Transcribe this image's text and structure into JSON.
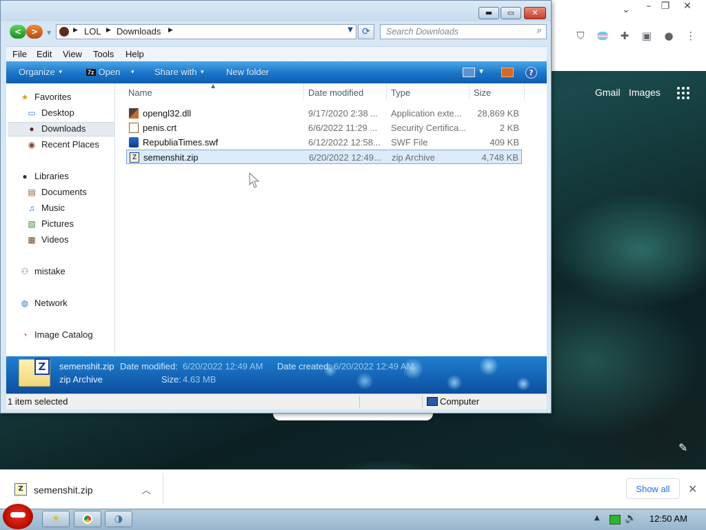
{
  "chrome": {
    "gmail_label": "Gmail",
    "images_label": "Images"
  },
  "explorer": {
    "address": {
      "crumbs": [
        "LOL",
        "Downloads"
      ]
    },
    "search": {
      "placeholder": "Search Downloads"
    },
    "menu": [
      "File",
      "Edit",
      "View",
      "Tools",
      "Help"
    ],
    "commands": {
      "organize": "Organize",
      "open": "Open",
      "share_with": "Share with",
      "new_folder": "New folder"
    },
    "nav": {
      "favorites": "Favorites",
      "desktop": "Desktop",
      "downloads": "Downloads",
      "recent_places": "Recent Places",
      "libraries": "Libraries",
      "documents": "Documents",
      "music": "Music",
      "pictures": "Pictures",
      "videos": "Videos",
      "mistake": "mistake",
      "network": "Network",
      "image_catalog": "Image Catalog"
    },
    "columns": {
      "name": "Name",
      "date_modified": "Date modified",
      "type": "Type",
      "size": "Size"
    },
    "files": [
      {
        "name": "opengl32.dll",
        "date": "9/17/2020 2:38 ...",
        "type": "Application exte...",
        "size": "28,869 KB",
        "icon": "dll-icon"
      },
      {
        "name": "penis.crt",
        "date": "6/6/2022 11:29 ...",
        "type": "Security Certifica...",
        "size": "2 KB",
        "icon": "certificate-icon"
      },
      {
        "name": "RepubliaTimes.swf",
        "date": "6/12/2022 12:58...",
        "type": "SWF File",
        "size": "409 KB",
        "icon": "swf-icon"
      },
      {
        "name": "semenshit.zip",
        "date": "6/20/2022 12:49...",
        "type": "zip Archive",
        "size": "4,748 KB",
        "icon": "zip-icon"
      }
    ],
    "details": {
      "name": "semenshit.zip",
      "type": "zip Archive",
      "date_modified_label": "Date modified:",
      "date_modified": "6/20/2022 12:49 AM",
      "date_created_label": "Date created:",
      "date_created": "6/20/2022 12:49 AM",
      "size_label": "Size:",
      "size": "4.63 MB"
    },
    "status": {
      "selection": "1 item selected",
      "location": "Computer"
    }
  },
  "downloads_bar": {
    "item_name": "semenshit.zip",
    "show_all": "Show all"
  },
  "taskbar": {
    "clock": "12:50 AM"
  }
}
